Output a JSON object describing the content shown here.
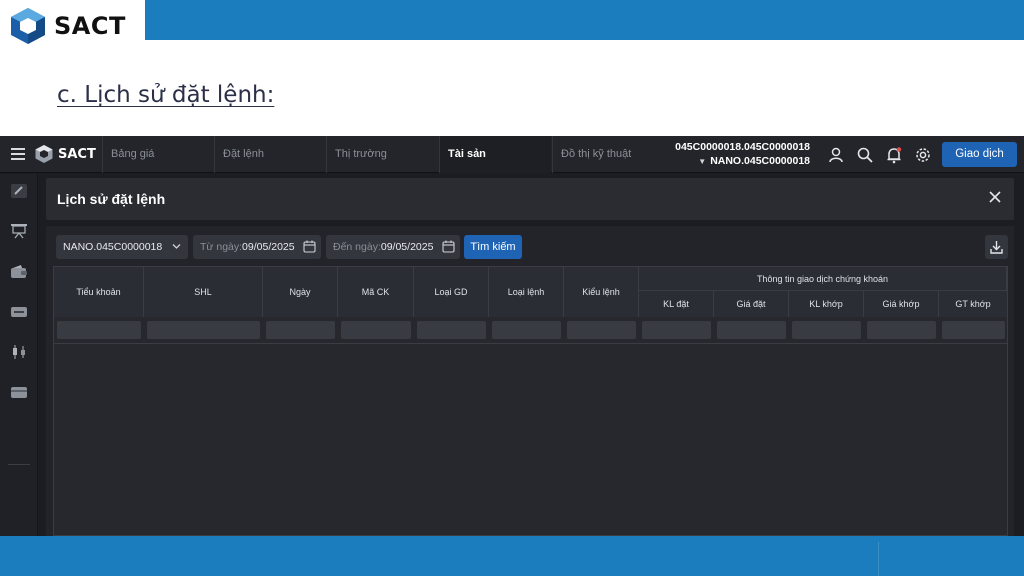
{
  "slide": {
    "logo_text": "SACT",
    "title": "c. Lịch sử đặt lệnh:"
  },
  "app": {
    "logo_text": "SACT",
    "nav_tabs": [
      "Bảng giá",
      "Đặt lệnh",
      "Thị trường",
      "Tài sản",
      "Đồ thị kỹ thuật"
    ],
    "active_tab": "Tài sản",
    "account": {
      "line1": "045C0000018.045C0000018",
      "line2": "NANO.045C0000018"
    },
    "trade_button": "Giao dịch",
    "sidebar_icons": [
      "pencil-icon",
      "presentation-icon",
      "wallet-icon",
      "transfer-icon",
      "candlestick-icon",
      "bank-card-icon"
    ],
    "panel_title": "Lịch sử đặt lệnh",
    "filters": {
      "account_select": "NANO.045C0000018",
      "from_label": "Từ ngày:",
      "from_value": "09/05/2025",
      "to_label": "Đến ngày:",
      "to_value": "09/05/2025",
      "search_button": "Tìm kiếm"
    },
    "table": {
      "columns": [
        "Tiểu khoản",
        "SHL",
        "Ngày",
        "Mã CK",
        "Loại GD",
        "Loại lệnh",
        "Kiểu lệnh"
      ],
      "group_header": "Thông tin giao dịch chứng khoán",
      "group_columns": [
        "KL đặt",
        "Giá đặt",
        "KL khớp",
        "Giá khớp",
        "GT khớp"
      ],
      "rows": []
    },
    "colors": {
      "accent_blue": "#1f63b4",
      "slide_band": "#1b7dbd",
      "app_bg": "#1b1d22"
    }
  }
}
